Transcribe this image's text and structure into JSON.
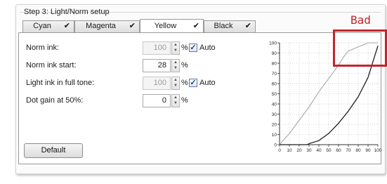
{
  "step_title": "Step 3: Light/Norm setup",
  "tabs": [
    {
      "label": "Cyan",
      "check": "✔",
      "active": false
    },
    {
      "label": "Magenta",
      "check": "✔",
      "active": false
    },
    {
      "label": "Yellow",
      "check": "✔",
      "active": true
    },
    {
      "label": "Black",
      "check": "✔",
      "active": false
    }
  ],
  "fields": [
    {
      "label": "Norm ink:",
      "value": "100",
      "disabled": true,
      "unit": "%",
      "auto": true,
      "auto_label": "Auto"
    },
    {
      "label": "Norm ink start:",
      "value": "28",
      "disabled": false,
      "unit": "%"
    },
    {
      "label": "Light ink in full tone:",
      "value": "100",
      "disabled": true,
      "unit": "%",
      "auto": true,
      "auto_label": "Auto"
    },
    {
      "label": "Dot gain at 50%:",
      "value": "0",
      "disabled": false,
      "unit": "%"
    }
  ],
  "default_button": "Default",
  "annotation": {
    "label": "Bad",
    "color": "#c0252d"
  },
  "chart_data": {
    "type": "line",
    "xlim": [
      0,
      100
    ],
    "ylim": [
      0,
      100
    ],
    "x_ticks": [
      "0",
      "10",
      "20",
      "30",
      "40",
      "50",
      "60",
      "70",
      "80",
      "90",
      "100"
    ],
    "y_ticks": [
      "0",
      "10",
      "20",
      "30",
      "40",
      "50",
      "60",
      "70",
      "80",
      "90",
      "100"
    ],
    "grid": true,
    "series": [
      {
        "color": "#b4b4b4",
        "x": [
          0,
          10,
          20,
          30,
          40,
          50,
          60,
          65,
          70,
          80,
          90,
          100
        ],
        "y": [
          0,
          11,
          24,
          37,
          52,
          65,
          78,
          86,
          92,
          96,
          100,
          100
        ]
      },
      {
        "color": "#1e1e1e",
        "x": [
          0,
          28,
          30,
          40,
          50,
          60,
          70,
          80,
          90,
          100
        ],
        "y": [
          0,
          0,
          1,
          4,
          11,
          21,
          33,
          47,
          66,
          97
        ]
      }
    ]
  }
}
